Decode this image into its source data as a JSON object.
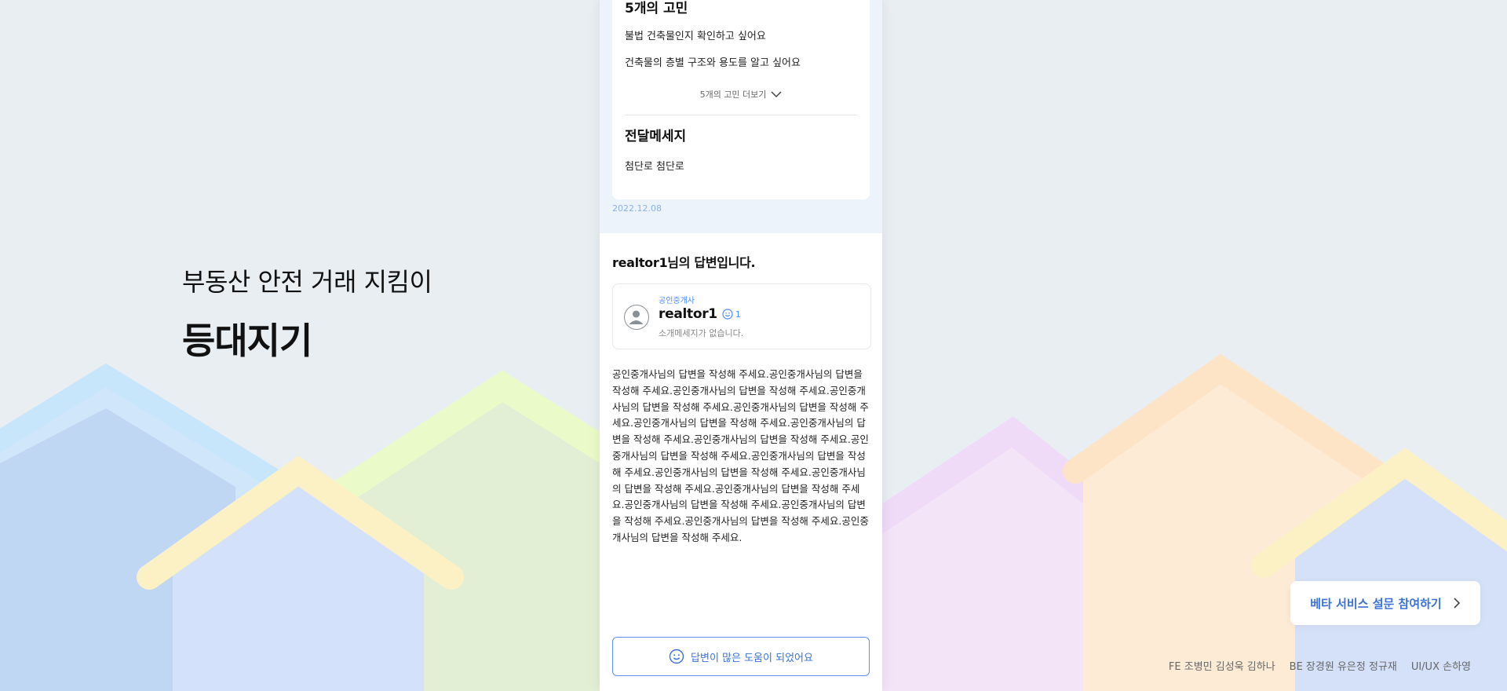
{
  "brand": {
    "tagline": "부동산 안전 거래 지킴이",
    "name": "등대지기"
  },
  "question": {
    "worries_title": "5개의 고민",
    "worries": [
      "불법 건축물인지 확인하고 싶어요",
      "건축물의 층별 구조와 용도를 알고 싶어요"
    ],
    "more_label": "5개의 고민 더보기",
    "message_title": "전달메세지",
    "message_body": "첨단로 첨단로",
    "date": "2022.12.08"
  },
  "answer": {
    "title": "realtor1님의 답변입니다.",
    "agent": {
      "role": "공인중개사",
      "name": "realtor1",
      "count": "1",
      "intro": "소개메세지가 없습니다."
    },
    "body": "공인중개사님의 답변을 작성해 주세요.공인중개사님의 답변을 작성해 주세요.공인중개사님의 답변을 작성해 주세요.공인중개사님의 답변을 작성해 주세요.공인중개사님의 답변을 작성해 주세요.공인중개사님의 답변을 작성해 주세요.공인중개사님의 답변을 작성해 주세요.공인중개사님의 답변을 작성해 주세요.공인중개사님의 답변을 작성해 주세요.공인중개사님의 답변을 작성해 주세요.공인중개사님의 답변을 작성해 주세요.공인중개사님의 답변을 작성해 주세요.공인중개사님의 답변을 작성해 주세요.공인중개사님의 답변을 작성해 주세요.공인중개사님의 답변을 작성해 주세요.공인중개사님의 답변을 작성해 주세요.공인중개사님의 답변을 작성해 주세요.",
    "helpful_label": "답변이 많은 도움이 되었어요"
  },
  "survey": {
    "label": "베타 서비스 설문 참여하기"
  },
  "credits": [
    "FE 조병민 김성욱 김하나",
    "BE 장경원 유은정 정규재",
    "UI/UX 손하영"
  ],
  "colors": {
    "accent": "#3a72d8",
    "background": "#e9eef3",
    "question_bg": "#edf3fb"
  },
  "icons": {
    "more": "chevron-down-icon",
    "count": "smile-icon",
    "helpful": "smile-icon",
    "survey": "chevron-right-icon",
    "avatar": "user-avatar-icon"
  }
}
